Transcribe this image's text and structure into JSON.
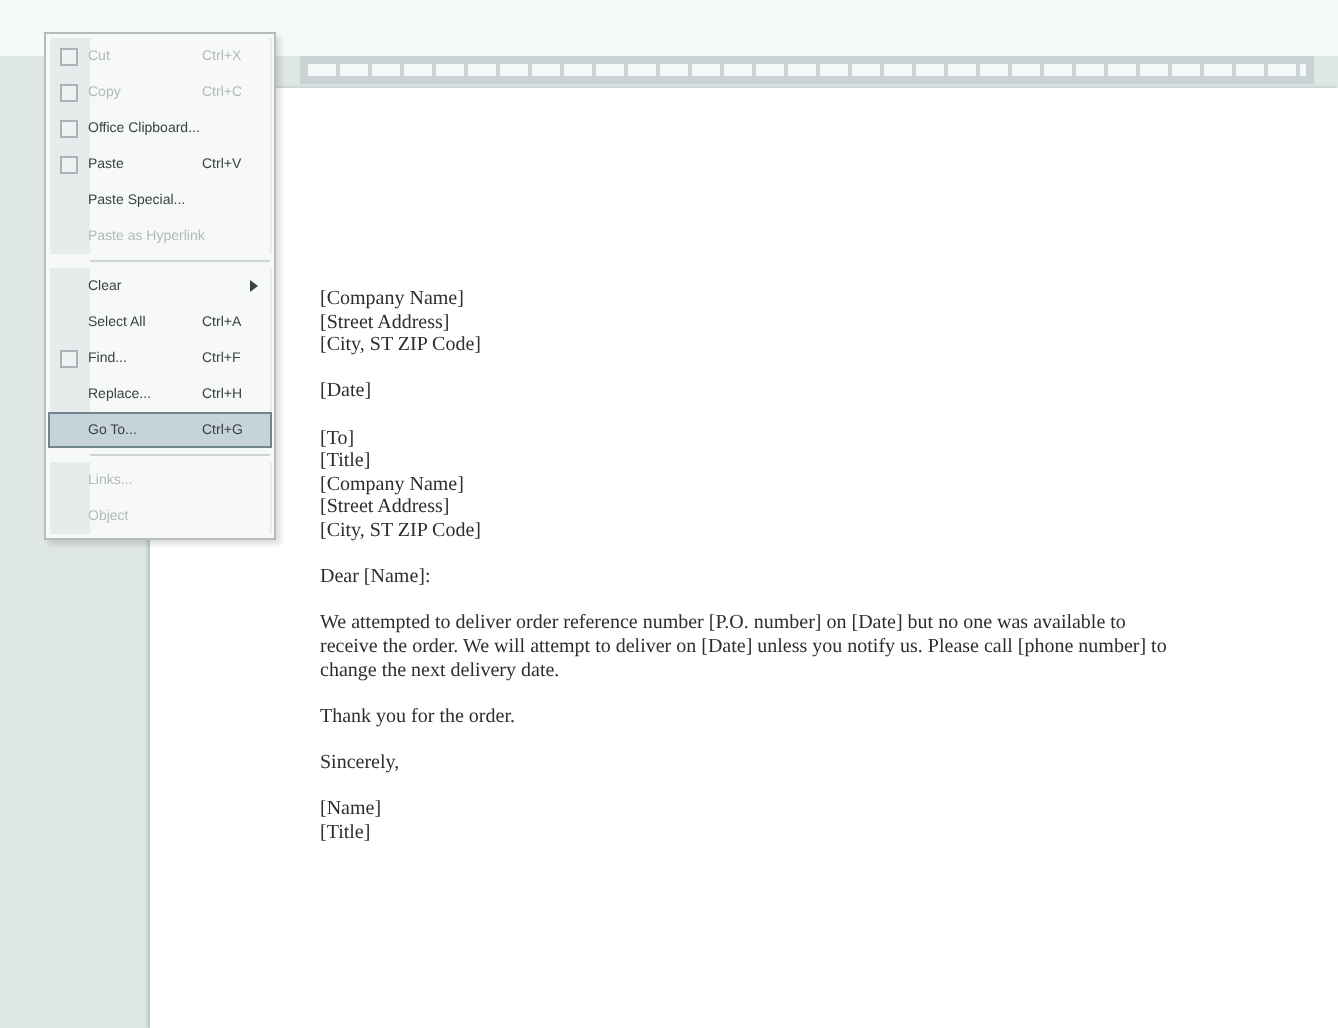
{
  "edit_menu": {
    "groups": [
      [
        {
          "label": "Cut",
          "shortcut": "Ctrl+X",
          "disabled": true,
          "selected": false,
          "icon": true
        },
        {
          "label": "Copy",
          "shortcut": "Ctrl+C",
          "disabled": true,
          "selected": false,
          "icon": true
        },
        {
          "label": "Office Clipboard...",
          "disabled": false,
          "selected": false,
          "icon": true
        },
        {
          "label": "Paste",
          "shortcut": "Ctrl+V",
          "disabled": false,
          "selected": false,
          "icon": true
        },
        {
          "label": "Paste Special...",
          "disabled": false,
          "selected": false,
          "icon": false
        },
        {
          "label": "Paste as Hyperlink",
          "disabled": true,
          "selected": false,
          "icon": false
        }
      ],
      [
        {
          "label": "Clear",
          "disabled": false,
          "selected": false,
          "icon": false,
          "submenu": true
        },
        {
          "label": "Select All",
          "shortcut": "Ctrl+A",
          "disabled": false,
          "selected": false,
          "icon": false
        },
        {
          "label": "Find...",
          "shortcut": "Ctrl+F",
          "disabled": false,
          "selected": false,
          "icon": true
        },
        {
          "label": "Replace...",
          "shortcut": "Ctrl+H",
          "disabled": false,
          "selected": false,
          "icon": false
        },
        {
          "label": "Go To...",
          "shortcut": "Ctrl+G",
          "disabled": false,
          "selected": true,
          "icon": false
        }
      ],
      [
        {
          "label": "Links...",
          "disabled": true,
          "selected": false,
          "icon": false
        },
        {
          "label": "Object",
          "disabled": true,
          "selected": false,
          "icon": false
        }
      ]
    ]
  },
  "letter": {
    "blocks": [
      {
        "lines": [
          "[Company Name]",
          "[Street Address]",
          "[City, ST  ZIP Code]"
        ]
      },
      {
        "lines": [
          "[Date]"
        ]
      },
      {
        "lines": [
          "[To]",
          "[Title]",
          "[Company Name]",
          "[Street Address]",
          "[City, ST  ZIP Code]"
        ]
      },
      {
        "lines": [
          "Dear [Name]:"
        ]
      },
      {
        "lines": [
          "We attempted to deliver order reference number [P.O. number] on [Date] but no one was available to receive the order.  We will attempt to deliver on [Date] unless you notify us. Please call [phone number] to change the next delivery date."
        ]
      },
      {
        "lines": [
          "Thank you for the order."
        ]
      },
      {
        "lines": [
          "Sincerely,"
        ]
      },
      {
        "lines": [
          "[Name]",
          "[Title]"
        ]
      }
    ]
  }
}
